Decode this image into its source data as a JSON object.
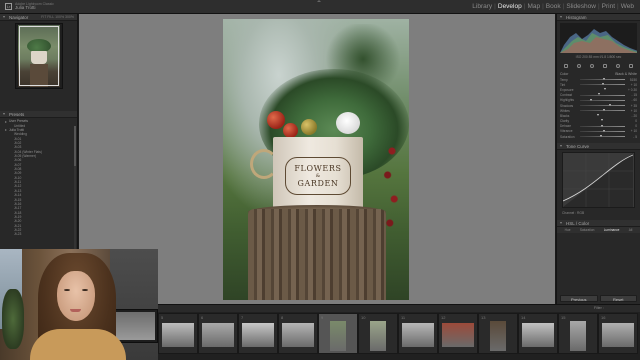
{
  "app": {
    "identity_line1": "Adobe Lightroom Classic",
    "user_name": "Julia Trotti"
  },
  "modules": [
    {
      "label": "Library",
      "active": false
    },
    {
      "label": "Develop",
      "active": true
    },
    {
      "label": "Map",
      "active": false
    },
    {
      "label": "Book",
      "active": false
    },
    {
      "label": "Slideshow",
      "active": false
    },
    {
      "label": "Print",
      "active": false
    },
    {
      "label": "Web",
      "active": false
    }
  ],
  "left_panel": {
    "navigator_title": "Navigator",
    "navigator_options": "FIT  FILL  100%  300%",
    "presets_title": "Presets",
    "preset_groups": [
      {
        "label": "User Presets",
        "items": [
          "Untitled"
        ]
      },
      {
        "label": "Julia Trotti",
        "items": [
          "Wedding",
          "Jt-01",
          "Jt-02",
          "Jt-03",
          "Jt-04 (Winter Flats)",
          "Jt-05 (Warmer)",
          "Jt-06",
          "Jt-07",
          "Jt-08",
          "Jt-09",
          "Jt-10",
          "Jt-11",
          "Jt-12",
          "Jt-13",
          "Jt-14",
          "Jt-15",
          "Jt-16",
          "Jt-17",
          "Jt-18",
          "Jt-19",
          "Jt-20",
          "Jt-21",
          "Jt-22",
          "Jt-23"
        ]
      }
    ]
  },
  "photo": {
    "pot_text_line1": "FLOWERS",
    "pot_text_line2": "&",
    "pot_text_line3": "GARDEN"
  },
  "right_panel": {
    "histogram_title": "Histogram",
    "histogram_readout": "ISO 200   85 mm   f/1.8   1/800 sec",
    "basic_treatment_color": "Color",
    "basic_treatment_bw": "Black & White",
    "basic_sliders": [
      {
        "label": "Temp",
        "value": "5150",
        "pos": 0.55
      },
      {
        "label": "Tint",
        "value": "+ 10",
        "pos": 0.52
      },
      {
        "label": "Exposure",
        "value": "+ 0.30",
        "pos": 0.56
      },
      {
        "label": "Contrast",
        "value": "- 15",
        "pos": 0.43
      },
      {
        "label": "Highlights",
        "value": "- 60",
        "pos": 0.25
      },
      {
        "label": "Shadows",
        "value": "+ 35",
        "pos": 0.68
      },
      {
        "label": "Whites",
        "value": "+ 10",
        "pos": 0.55
      },
      {
        "label": "Blacks",
        "value": "- 20",
        "pos": 0.4
      },
      {
        "label": "Clarity",
        "value": "0",
        "pos": 0.5
      },
      {
        "label": "Dehaze",
        "value": "0",
        "pos": 0.5
      },
      {
        "label": "Vibrance",
        "value": "+ 10",
        "pos": 0.55
      },
      {
        "label": "Saturation",
        "value": "- 5",
        "pos": 0.47
      }
    ],
    "tone_curve_title": "Tone Curve",
    "tone_curve_channel": "Channel :  RGB",
    "hsl_title": "HSL / Color",
    "hsl_tabs": [
      "Hue",
      "Saturation",
      "Luminance",
      "All"
    ],
    "hsl_active_tab": "Luminance",
    "previous_button": "Previous",
    "reset_button": "Reset"
  },
  "filmstrip": {
    "info": "Filter :",
    "frames": [
      {
        "num": "5",
        "portrait": false,
        "selected": false
      },
      {
        "num": "6",
        "portrait": false,
        "selected": false
      },
      {
        "num": "7",
        "portrait": false,
        "selected": false
      },
      {
        "num": "8",
        "portrait": false,
        "selected": false
      },
      {
        "num": "9",
        "portrait": true,
        "selected": true
      },
      {
        "num": "10",
        "portrait": true,
        "selected": false
      },
      {
        "num": "11",
        "portrait": false,
        "selected": false
      },
      {
        "num": "12",
        "portrait": false,
        "selected": false
      },
      {
        "num": "13",
        "portrait": true,
        "selected": false
      },
      {
        "num": "14",
        "portrait": false,
        "selected": false
      },
      {
        "num": "15",
        "portrait": true,
        "selected": false
      },
      {
        "num": "16",
        "portrait": false,
        "selected": false
      }
    ]
  },
  "colors": {
    "canvas_bg": "#7e7e7e",
    "panel_bg": "#282828",
    "active_module": "#e8e8e8"
  }
}
